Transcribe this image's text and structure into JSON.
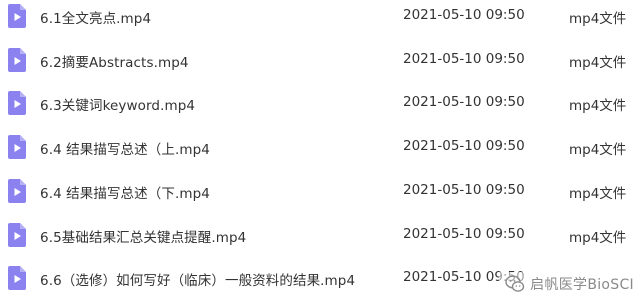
{
  "colors": {
    "icon_fill": "#8B82F0",
    "icon_fold": "#B6B0F6",
    "icon_play": "#FFFFFF",
    "text": "#333333",
    "watermark": "#8A8A8A"
  },
  "files": [
    {
      "icon": "video-file-icon",
      "name": "6.1全文亮点.mp4",
      "date": "2021-05-10 09:50",
      "type": "mp4文件"
    },
    {
      "icon": "video-file-icon",
      "name": "6.2摘要Abstracts.mp4",
      "date": "2021-05-10 09:50",
      "type": "mp4文件"
    },
    {
      "icon": "video-file-icon",
      "name": "6.3关键词keyword.mp4",
      "date": "2021-05-10 09:50",
      "type": "mp4文件"
    },
    {
      "icon": "video-file-icon",
      "name": "6.4 结果描写总述（上.mp4",
      "date": "2021-05-10 09:50",
      "type": "mp4文件"
    },
    {
      "icon": "video-file-icon",
      "name": "6.4 结果描写总述（下.mp4",
      "date": "2021-05-10 09:50",
      "type": "mp4文件"
    },
    {
      "icon": "video-file-icon",
      "name": "6.5基础结果汇总关键点提醒.mp4",
      "date": "2021-05-10 09:50",
      "type": "mp4文件"
    },
    {
      "icon": "video-file-icon",
      "name": "6.6（选修）如何写好（临床）一般资料的结果.mp4",
      "date": "2021-05-10 09:50",
      "type": ""
    }
  ],
  "watermark": {
    "icon": "wechat-logo-icon",
    "text": "启帆医学BioSCI"
  }
}
